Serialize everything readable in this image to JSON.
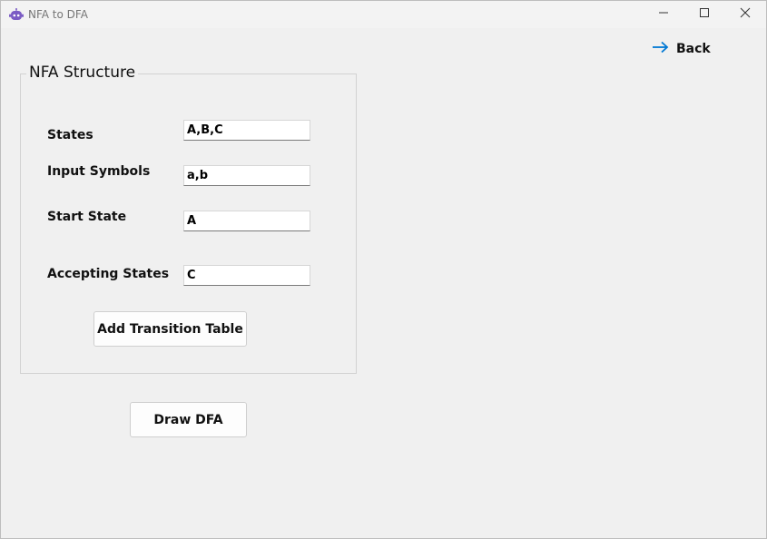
{
  "window": {
    "title": "NFA to DFA",
    "app_icon": "robot-icon",
    "controls": [
      "minimize-icon",
      "maximize-icon",
      "close-icon"
    ]
  },
  "nav": {
    "back_label": "Back",
    "back_icon": "arrow-right-icon",
    "accent": "#0078d4"
  },
  "nfa_group": {
    "title": "NFA Structure",
    "fields": {
      "states": {
        "label": "States",
        "value": "A,B,C"
      },
      "input_symbols": {
        "label": "Input Symbols",
        "value": "a,b"
      },
      "start_state": {
        "label": "Start State",
        "value": "A"
      },
      "accepting_states": {
        "label": "Accepting States",
        "value": "C"
      }
    },
    "add_transition_label": "Add Transition Table"
  },
  "actions": {
    "draw_dfa_label": "Draw DFA"
  }
}
